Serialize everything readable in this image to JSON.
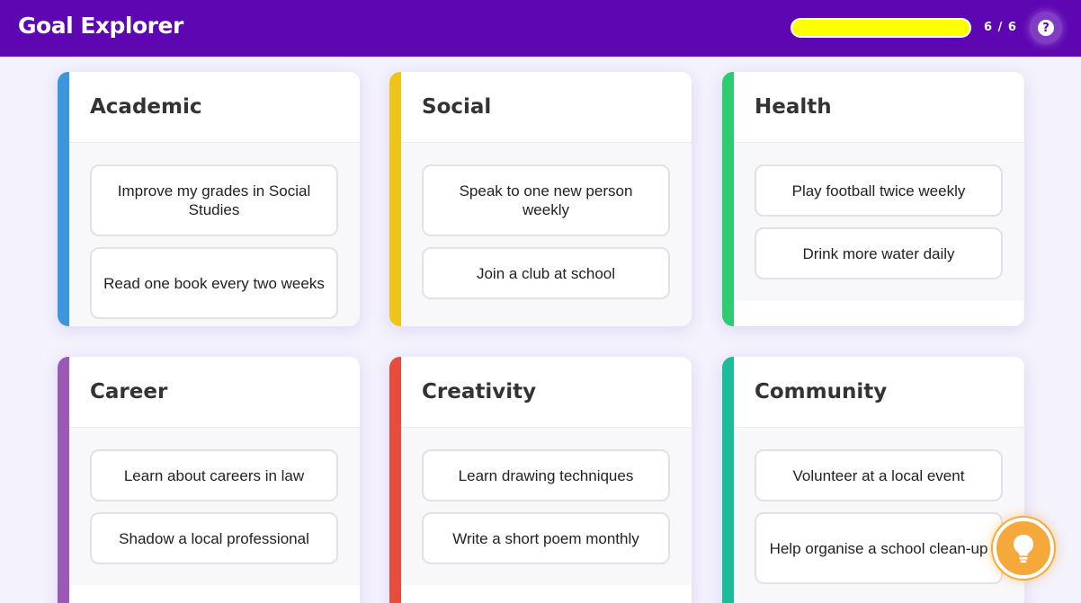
{
  "header": {
    "title": "Goal Explorer",
    "progress_text": "6 / 6",
    "progress_value": 1.0,
    "help_label": "?"
  },
  "colors": {
    "header_bg": "#5d06b2",
    "progress_fill": "#ffff00",
    "academic": "#3a97db",
    "social": "#f0c419",
    "health": "#2ecc71",
    "career": "#9b59b6",
    "creativity": "#e74c3c",
    "community": "#1abc9c",
    "bulb": "#f6a93b"
  },
  "categories": [
    {
      "title": "Academic",
      "goals": [
        "Improve my grades in Social Studies",
        "Read one book every two weeks"
      ]
    },
    {
      "title": "Social",
      "goals": [
        "Speak to one new person weekly",
        "Join a club at school"
      ]
    },
    {
      "title": "Health",
      "goals": [
        "Play football twice weekly",
        "Drink more water daily"
      ]
    },
    {
      "title": "Career",
      "goals": [
        "Learn about careers in law",
        "Shadow a local professional"
      ]
    },
    {
      "title": "Creativity",
      "goals": [
        "Learn drawing techniques",
        "Write a short poem monthly"
      ]
    },
    {
      "title": "Community",
      "goals": [
        "Volunteer at a local event",
        "Help organise a school clean-up"
      ]
    }
  ],
  "icons": {
    "help": "question-icon",
    "hint": "lightbulb-icon"
  }
}
